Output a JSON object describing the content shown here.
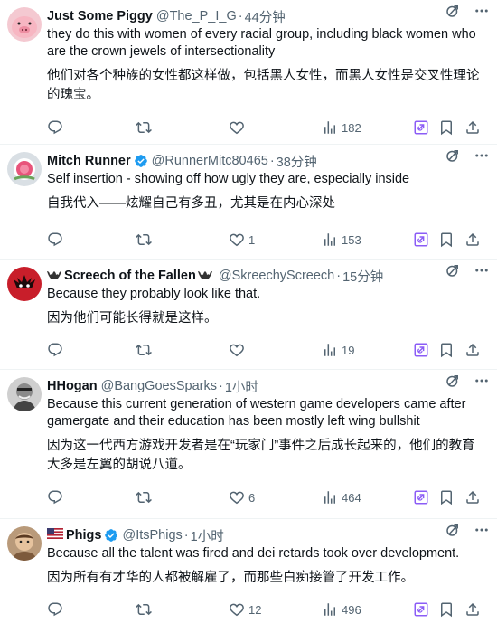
{
  "tweets": [
    {
      "name": "Just Some Piggy",
      "handle": "@The_P_I_G",
      "time": "44分钟",
      "verified": false,
      "text": "they do this with women of every racial group, including black women who are the crown jewels of intersectionality",
      "translation": "他们对各个种族的女性都这样做，包括黑人女性，而黑人女性是交叉性理论的瑰宝。",
      "likes": "",
      "views": "182"
    },
    {
      "name": "Mitch Runner",
      "handle": "@RunnerMitc80465",
      "time": "38分钟",
      "verified": true,
      "text": "Self insertion - showing off how ugly they are, especially inside",
      "translation": "自我代入——炫耀自己有多丑，尤其是在内心深处",
      "likes": "1",
      "views": "153"
    },
    {
      "name": "Screech of the Fallen",
      "handle": "@SkreechyScreech",
      "time": "15分钟",
      "verified": false,
      "text": "Because they probably look like that.",
      "translation": "因为他们可能长得就是这样。",
      "likes": "",
      "views": "19"
    },
    {
      "name": "HHogan",
      "handle": "@BangGoesSparks",
      "time": "1小时",
      "verified": false,
      "text": "Because this current generation of western game developers came after gamergate and their education has been mostly left wing bullshit",
      "translation": "因为这一代西方游戏开发者是在“玩家门”事件之后成长起来的，他们的教育大多是左翼的胡说八道。",
      "likes": "6",
      "views": "464"
    },
    {
      "name": "Phigs",
      "handle": "@ItsPhigs",
      "time": "1小时",
      "verified": true,
      "text": "Because all the talent was fired and dei retards took over development.",
      "translation": "因为所有有才华的人都被解雇了，而那些白痴接管了开发工作。",
      "likes": "12",
      "views": "496"
    }
  ],
  "dot": "·",
  "colors": {
    "text": "#0f1419",
    "muted": "#536471",
    "blue": "#1d9bf0",
    "grok": "#8b5cf6"
  },
  "icons": [
    "reply-icon",
    "retweet-icon",
    "like-icon",
    "views-icon",
    "grok-icon",
    "bookmark-icon",
    "share-icon",
    "more-icon",
    "verified-icon"
  ]
}
